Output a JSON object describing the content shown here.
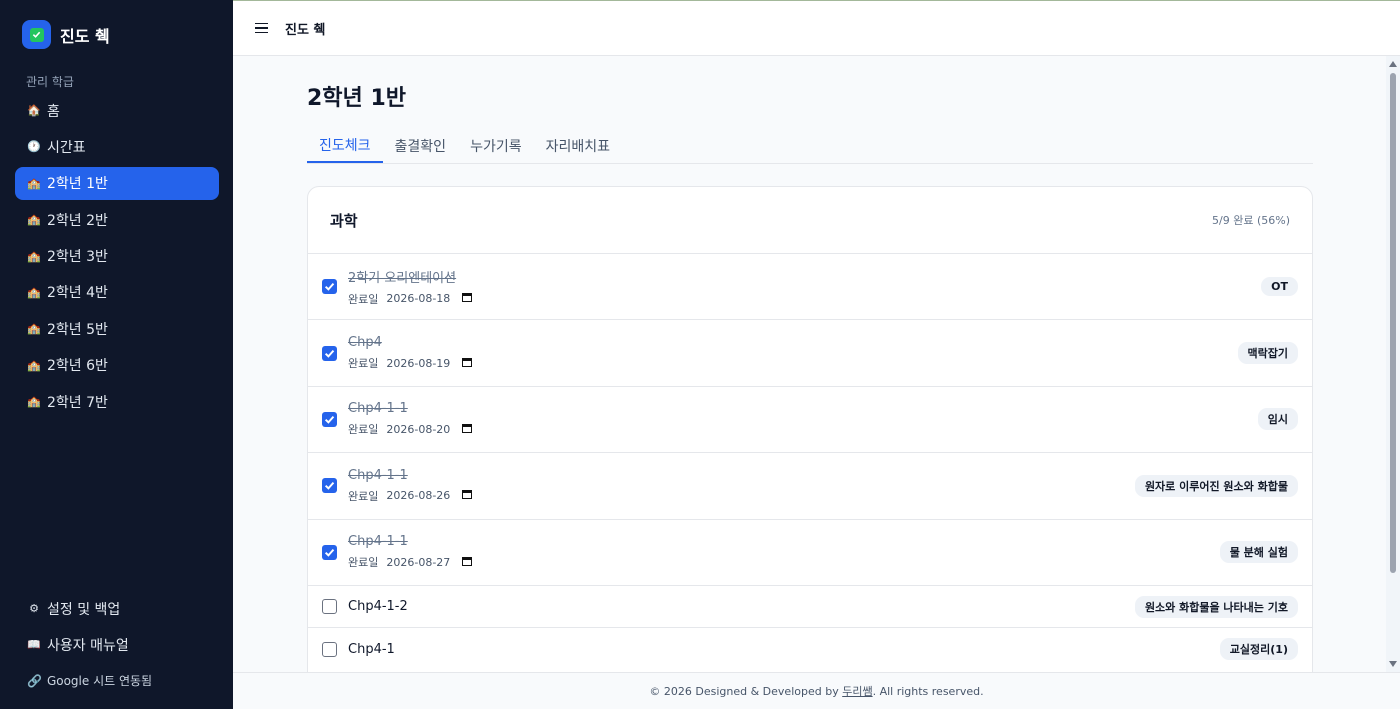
{
  "sidebar": {
    "brand_title": "진도 췍",
    "section_label": "관리 학급",
    "items": [
      {
        "label": "홈",
        "icon": "house-icon"
      },
      {
        "label": "시간표",
        "icon": "clock-icon"
      },
      {
        "label": "2학년 1반",
        "icon": "school-icon",
        "active": true
      },
      {
        "label": "2학년 2반",
        "icon": "school-icon"
      },
      {
        "label": "2학년 3반",
        "icon": "school-icon"
      },
      {
        "label": "2학년 4반",
        "icon": "school-icon"
      },
      {
        "label": "2학년 5반",
        "icon": "school-icon"
      },
      {
        "label": "2학년 6반",
        "icon": "school-icon"
      },
      {
        "label": "2학년 7반",
        "icon": "school-icon"
      }
    ],
    "bottom": {
      "settings": "설정 및 백업",
      "manual": "사용자 매뉴얼",
      "google_status": "Google 시트 연동됨"
    }
  },
  "topbar": {
    "title": "진도 췍"
  },
  "main": {
    "page_title": "2학년 1반",
    "tabs": [
      "진도체크",
      "출결확인",
      "누가기록",
      "자리배치표"
    ],
    "active_tab": 0,
    "card": {
      "subject": "과학",
      "progress_text": "5/9 완료 (56%)",
      "date_label": "완료일",
      "rows": [
        {
          "name": "2학기 오리엔테이션",
          "done": true,
          "date": "2026-08-18",
          "tag": "OT"
        },
        {
          "name": "Chp4",
          "done": true,
          "date": "2026-08-19",
          "tag": "맥락잡기"
        },
        {
          "name": "Chp4-1-1",
          "done": true,
          "date": "2026-08-20",
          "tag": "임시"
        },
        {
          "name": "Chp4-1-1",
          "done": true,
          "date": "2026-08-26",
          "tag": "원자로 이루어진 원소와 화합물"
        },
        {
          "name": "Chp4-1-1",
          "done": true,
          "date": "2026-08-27",
          "tag": "물 분해 실험"
        },
        {
          "name": "Chp4-1-2",
          "done": false,
          "tag": "원소와 화합물을 나타내는 기호"
        },
        {
          "name": "Chp4-1",
          "done": false,
          "tag": "교실정리(1)"
        }
      ]
    }
  },
  "footer": {
    "prefix": "© 2026 Designed & Developed by ",
    "author": "두리쌤",
    "suffix": ". All rights reserved."
  },
  "colors": {
    "sidebar_bg": "#0f172a",
    "accent": "#2563eb"
  }
}
